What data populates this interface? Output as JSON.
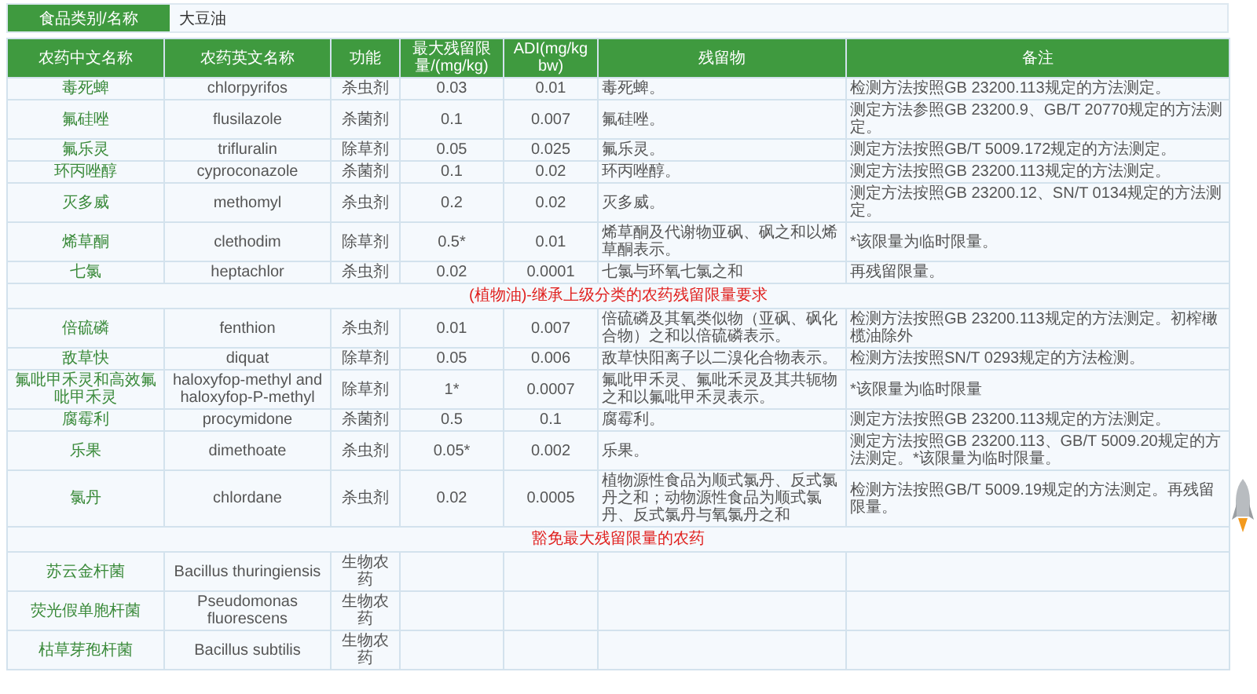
{
  "food": {
    "label": "食品类别/名称",
    "value": "大豆油"
  },
  "table": {
    "columns": [
      "农药中文名称",
      "农药英文名称",
      "功能",
      "最大残留限量/(mg/kg)",
      "ADI(mg/kg bw)",
      "残留物",
      "备注"
    ],
    "rows": [
      {
        "kind": "pesticide",
        "cells": [
          "毒死蜱",
          "chlorpyrifos",
          "杀虫剂",
          "0.03",
          "0.01",
          "毒死蜱。",
          "检测方法按照GB 23200.113规定的方法测定。"
        ]
      },
      {
        "kind": "pesticide",
        "cells": [
          "氟硅唑",
          "flusilazole",
          "杀菌剂",
          "0.1",
          "0.007",
          "氟硅唑。",
          "测定方法参照GB 23200.9、GB/T 20770规定的方法测定。"
        ]
      },
      {
        "kind": "pesticide",
        "cells": [
          "氟乐灵",
          "trifluralin",
          "除草剂",
          "0.05",
          "0.025",
          "氟乐灵。",
          "测定方法按照GB/T 5009.172规定的方法测定。"
        ]
      },
      {
        "kind": "pesticide",
        "cells": [
          "环丙唑醇",
          "cyproconazole",
          "杀菌剂",
          "0.1",
          "0.02",
          "环丙唑醇。",
          "测定方法按照GB 23200.113规定的方法测定。"
        ]
      },
      {
        "kind": "pesticide",
        "cells": [
          "灭多威",
          "methomyl",
          "杀虫剂",
          "0.2",
          "0.02",
          "灭多威。",
          "测定方法按照GB 23200.12、SN/T 0134规定的方法测定。"
        ]
      },
      {
        "kind": "pesticide",
        "cells": [
          "烯草酮",
          "clethodim",
          "除草剂",
          "0.5*",
          "0.01",
          "烯草酮及代谢物亚砜、砜之和以烯草酮表示。",
          "*该限量为临时限量。"
        ]
      },
      {
        "kind": "pesticide",
        "cells": [
          "七氯",
          "heptachlor",
          "杀虫剂",
          "0.02",
          "0.0001",
          "七氯与环氧七氯之和",
          "再残留限量。"
        ]
      },
      {
        "kind": "section",
        "title": "(植物油)-继承上级分类的农药残留限量要求"
      },
      {
        "kind": "pesticide",
        "cells": [
          "倍硫磷",
          "fenthion",
          "杀虫剂",
          "0.01",
          "0.007",
          "倍硫磷及其氧类似物（亚砜、砜化合物）之和以倍硫磷表示。",
          "检测方法按照GB 23200.113规定的方法测定。初榨橄榄油除外"
        ]
      },
      {
        "kind": "pesticide",
        "cells": [
          "敌草快",
          "diquat",
          "除草剂",
          "0.05",
          "0.006",
          "敌草快阳离子以二溴化合物表示。",
          "检测方法按照SN/T 0293规定的方法检测。"
        ]
      },
      {
        "kind": "pesticide",
        "cells": [
          "氟吡甲禾灵和高效氟吡甲禾灵",
          "haloxyfop-methyl and haloxyfop-P-methyl",
          "除草剂",
          "1*",
          "0.0007",
          "氟吡甲禾灵、氟吡禾灵及其共轭物之和以氟吡甲禾灵表示。",
          "*该限量为临时限量"
        ]
      },
      {
        "kind": "pesticide",
        "cells": [
          "腐霉利",
          "procymidone",
          "杀菌剂",
          "0.5",
          "0.1",
          "腐霉利。",
          "测定方法按照GB 23200.113规定的方法测定。"
        ]
      },
      {
        "kind": "pesticide",
        "cells": [
          "乐果",
          "dimethoate",
          "杀虫剂",
          "0.05*",
          "0.002",
          "乐果。",
          "测定方法按照GB 23200.113、GB/T 5009.20规定的方法测定。*该限量为临时限量。"
        ]
      },
      {
        "kind": "pesticide",
        "cells": [
          "氯丹",
          "chlordane",
          "杀虫剂",
          "0.02",
          "0.0005",
          "植物源性食品为顺式氯丹、反式氯丹之和；动物源性食品为顺式氯丹、反式氯丹与氧氯丹之和",
          "检测方法按照GB/T 5009.19规定的方法测定。再残留限量。"
        ]
      },
      {
        "kind": "section",
        "title": "豁免最大残留限量的农药"
      },
      {
        "kind": "pesticide",
        "cells": [
          "苏云金杆菌",
          "Bacillus thuringiensis",
          "生物农药"
        ]
      },
      {
        "kind": "pesticide",
        "cells": [
          "荧光假单胞杆菌",
          "Pseudomonas fluorescens",
          "生物农药"
        ]
      },
      {
        "kind": "pesticide",
        "cells": [
          "枯草芽孢杆菌",
          "Bacillus subtilis",
          "生物农药"
        ]
      }
    ]
  }
}
